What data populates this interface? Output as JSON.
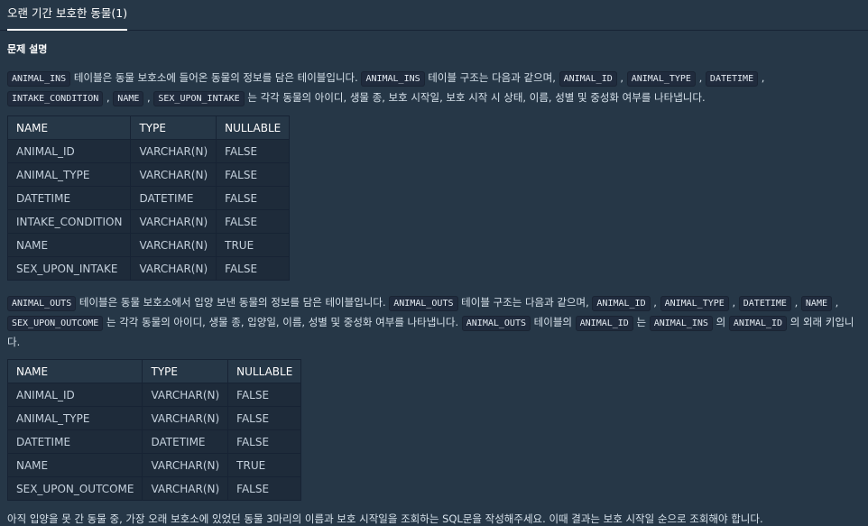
{
  "tab": {
    "label": "오랜 기간 보호한 동물(1)"
  },
  "section_title": "문제 설명",
  "para1": {
    "code1": "ANIMAL_INS",
    "text1": " 테이블은 동물 보호소에 들어온 동물의 정보를 담은 테이블입니다. ",
    "code2": "ANIMAL_INS",
    "text2": " 테이블 구조는 다음과 같으며, ",
    "code3": "ANIMAL_ID",
    "sep1": " , ",
    "code4": "ANIMAL_TYPE",
    "sep2": " , ",
    "code5": "DATETIME",
    "sep3": " , ",
    "code6": "INTAKE_CONDITION",
    "sep4": " , ",
    "code7": "NAME",
    "sep5": " , ",
    "code8": "SEX_UPON_INTAKE",
    "text3": " 는 각각 동물의 아이디, 생물 종, 보호 시작일, 보호 시작 시 상태, 이름, 성별 및 중성화 여부를 나타냅니다."
  },
  "table1": {
    "headers": [
      "NAME",
      "TYPE",
      "NULLABLE"
    ],
    "rows": [
      [
        "ANIMAL_ID",
        "VARCHAR(N)",
        "FALSE"
      ],
      [
        "ANIMAL_TYPE",
        "VARCHAR(N)",
        "FALSE"
      ],
      [
        "DATETIME",
        "DATETIME",
        "FALSE"
      ],
      [
        "INTAKE_CONDITION",
        "VARCHAR(N)",
        "FALSE"
      ],
      [
        "NAME",
        "VARCHAR(N)",
        "TRUE"
      ],
      [
        "SEX_UPON_INTAKE",
        "VARCHAR(N)",
        "FALSE"
      ]
    ]
  },
  "para2": {
    "code1": "ANIMAL_OUTS",
    "text1": " 테이블은 동물 보호소에서 입양 보낸 동물의 정보를 담은 테이블입니다. ",
    "code2": "ANIMAL_OUTS",
    "text2": " 테이블 구조는 다음과 같으며, ",
    "code3": "ANIMAL_ID",
    "sep1": " , ",
    "code4": "ANIMAL_TYPE",
    "sep2": " , ",
    "code5": "DATETIME",
    "sep3": " , ",
    "code6": "NAME",
    "sep4": " , ",
    "code7": "SEX_UPON_OUTCOME",
    "text3": " 는 각각 동물의 아이디, 생물 종, 입양일, 이름, 성별 및 중성화 여부를 나타냅니다. ",
    "code8": "ANIMAL_OUTS",
    "text4": " 테이블의 ",
    "code9": "ANIMAL_ID",
    "text5": " 는 ",
    "code10": "ANIMAL_INS",
    "text6": " 의 ",
    "code11": "ANIMAL_ID",
    "text7": " 의 외래 키입니다."
  },
  "table2": {
    "headers": [
      "NAME",
      "TYPE",
      "NULLABLE"
    ],
    "rows": [
      [
        "ANIMAL_ID",
        "VARCHAR(N)",
        "FALSE"
      ],
      [
        "ANIMAL_TYPE",
        "VARCHAR(N)",
        "FALSE"
      ],
      [
        "DATETIME",
        "DATETIME",
        "FALSE"
      ],
      [
        "NAME",
        "VARCHAR(N)",
        "TRUE"
      ],
      [
        "SEX_UPON_OUTCOME",
        "VARCHAR(N)",
        "FALSE"
      ]
    ]
  },
  "final_text": "아직 입양을 못 간 동물 중, 가장 오래 보호소에 있었던 동물 3마리의 이름과 보호 시작일을 조회하는 SQL문을 작성해주세요. 이때 결과는 보호 시작일 순으로 조회해야 합니다."
}
